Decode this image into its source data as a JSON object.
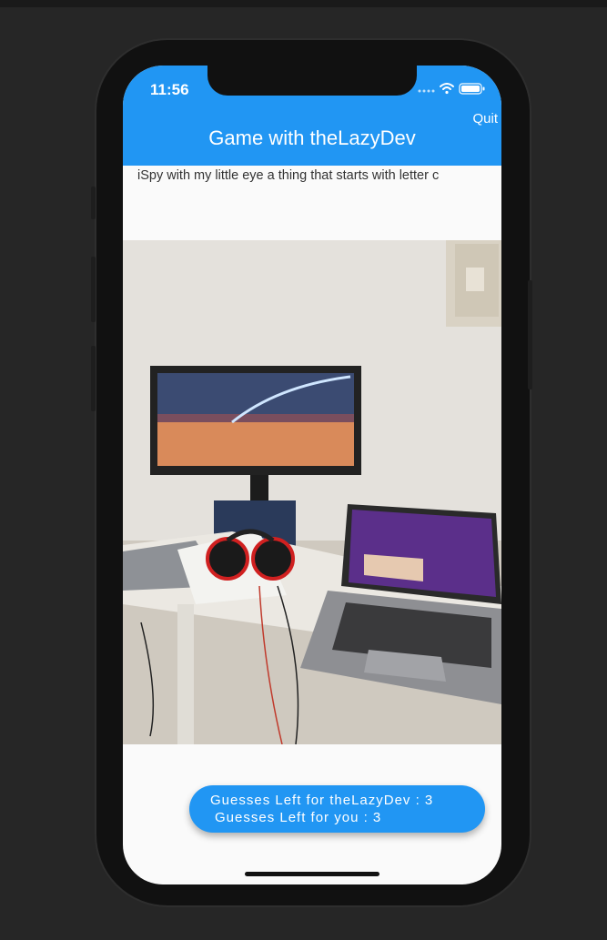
{
  "status_bar": {
    "time": "11:56"
  },
  "app_bar": {
    "title": "Game with theLazyDev",
    "quit_label": "Quit"
  },
  "prompt": {
    "text": "iSpy with my little eye a thing that starts with letter c"
  },
  "guesses_button": {
    "line1": "Guesses Left for theLazyDev : 3",
    "line2": "Guesses Left for you : 3"
  },
  "colors": {
    "primary": "#2196f3",
    "background": "#262626",
    "screen": "#fafafa"
  },
  "icons": [
    "signal-dots-icon",
    "wifi-icon",
    "battery-icon"
  ]
}
